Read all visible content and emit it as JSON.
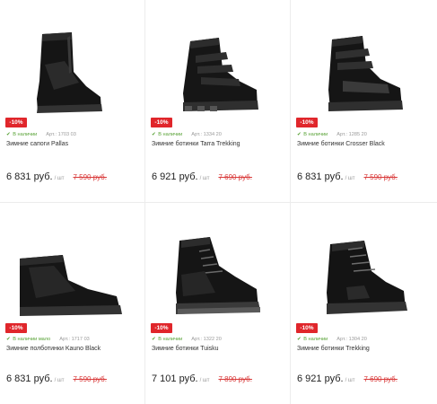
{
  "products": [
    {
      "badge": "-10%",
      "stock": "В наличии",
      "article": "Арт.: 1703 03",
      "name": "Зимние сапоги Pallas",
      "price": "6 831 руб.",
      "unit": "/ шт",
      "old_price": "7 590 руб.",
      "icon": "tall-winter-boot"
    },
    {
      "badge": "-10%",
      "stock": "В наличии",
      "article": "Арт.: 1334 20",
      "name": "Зимние ботинки Tarra Trekking",
      "price": "6 921 руб.",
      "unit": "/ шт",
      "old_price": "7 690 руб.",
      "icon": "velcro-winter-boot"
    },
    {
      "badge": "-10%",
      "stock": "В наличии",
      "article": "Арт.: 1285 20",
      "name": "Зимние ботинки Crosser Black",
      "price": "6 831 руб.",
      "unit": "/ шт",
      "old_price": "7 590 руб.",
      "icon": "velcro-winter-boot"
    },
    {
      "badge": "-10%",
      "stock": "В наличии мало",
      "article": "Арт.: 1717 03",
      "name": "Зимние полботинки Kauno Black",
      "price": "6 831 руб.",
      "unit": "/ шт",
      "old_price": "7 590 руб.",
      "icon": "low-winter-boot"
    },
    {
      "badge": "-10%",
      "stock": "В наличии",
      "article": "Арт.: 1322 20",
      "name": "Зимние ботинки Tuisku",
      "price": "7 101 руб.",
      "unit": "/ шт",
      "old_price": "7 890 руб.",
      "icon": "lace-winter-boot"
    },
    {
      "badge": "-10%",
      "stock": "В наличии",
      "article": "Арт.: 1304 20",
      "name": "Зимние ботинки Trekking",
      "price": "6 921 руб.",
      "unit": "/ шт",
      "old_price": "7 690 руб.",
      "icon": "lace-winter-boot"
    }
  ],
  "colors": {
    "badge": "#e0262b",
    "stock": "#58a236",
    "old_price": "#d93a3a",
    "boot": "#1a1a1a"
  }
}
